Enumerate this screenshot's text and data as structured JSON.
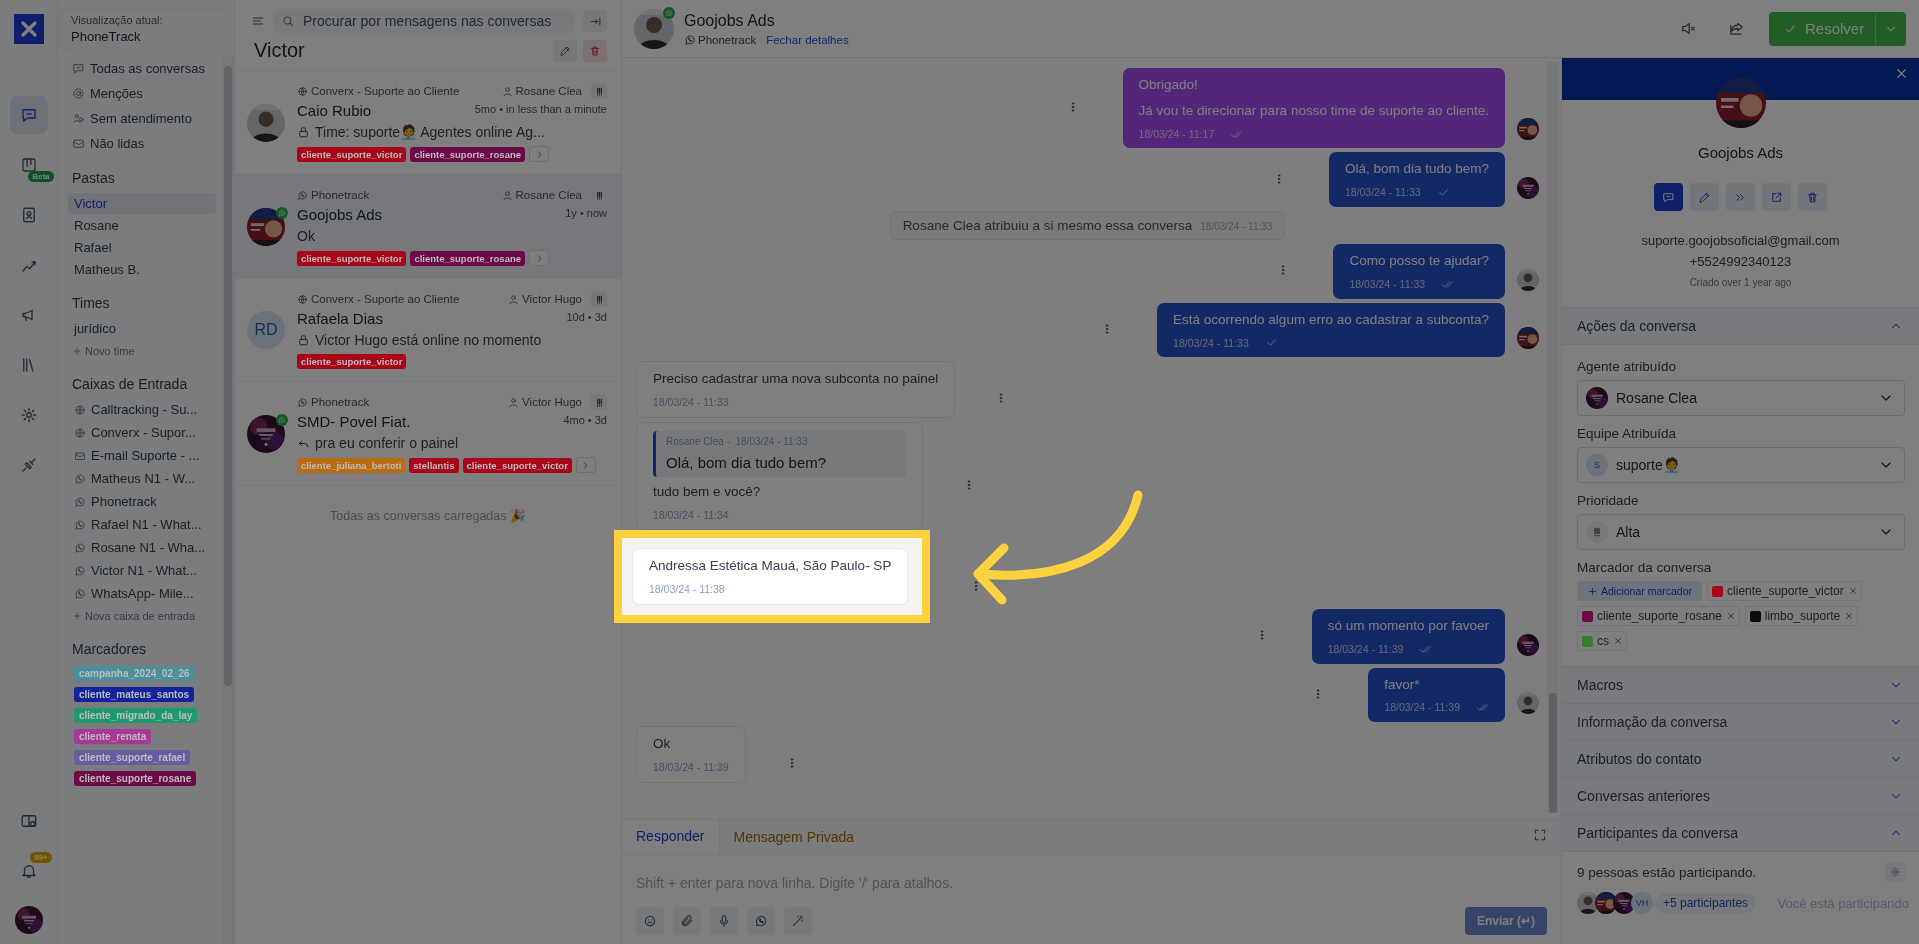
{
  "rail": {
    "items": [
      {
        "kind": "chat",
        "selected": true
      },
      {
        "kind": "board",
        "selected": false,
        "badge": "Beta"
      },
      {
        "kind": "contact",
        "selected": false
      },
      {
        "kind": "chart",
        "selected": false
      },
      {
        "kind": "megaphone",
        "selected": false
      },
      {
        "kind": "books",
        "selected": false
      },
      {
        "kind": "gear",
        "selected": false
      },
      {
        "kind": "plug",
        "selected": false
      }
    ],
    "bottom": [
      {
        "kind": "layout"
      },
      {
        "kind": "bell",
        "badge": "99+"
      }
    ],
    "avatar": {
      "kind": "picture"
    }
  },
  "sidebar": {
    "view": {
      "label": "Visualização atual:",
      "value": "PhoneTrack"
    },
    "nav": [
      {
        "kind": "chat",
        "label": "Todas as conversas"
      },
      {
        "kind": "mention",
        "label": "Menções"
      },
      {
        "kind": "people",
        "label": "Sem atendimento"
      },
      {
        "kind": "inbox",
        "label": "Não lidas"
      }
    ],
    "folders": {
      "title": "Pastas",
      "items": [
        {
          "label": "Victor",
          "selected": true
        },
        {
          "label": "Rosane",
          "selected": false
        },
        {
          "label": "Rafael",
          "selected": false
        },
        {
          "label": "Matheus B.",
          "selected": false
        }
      ]
    },
    "teams": {
      "title": "Times",
      "items": [
        "jurídico"
      ],
      "add": "Novo time"
    },
    "inboxes": {
      "title": "Caixas de Entrada",
      "items": [
        {
          "kind": "web",
          "label": "Calltracking - Su..."
        },
        {
          "kind": "web",
          "label": "Converx - Supor..."
        },
        {
          "kind": "email",
          "label": "E-mail Suporte - ..."
        },
        {
          "kind": "whatsapp",
          "label": "Matheus N1 - W..."
        },
        {
          "kind": "whatsapp",
          "label": "Phonetrack"
        },
        {
          "kind": "whatsapp",
          "label": "Rafael N1 - What..."
        },
        {
          "kind": "whatsapp",
          "label": "Rosane N1 - Wha..."
        },
        {
          "kind": "whatsapp",
          "label": "Victor N1 - What..."
        },
        {
          "kind": "whatsapp",
          "label": "WhatsApp- Mile..."
        }
      ],
      "add": "Nova caixa de entrada"
    },
    "labels": {
      "title": "Marcadores",
      "items": [
        {
          "label": "campanha_2024_02_26",
          "color": "#4a8f9b"
        },
        {
          "label": "cliente_mateus_santos",
          "color": "#14229c"
        },
        {
          "label": "cliente_migrado_da_lay",
          "color": "#1f9a70"
        },
        {
          "label": "cliente_renata",
          "color": "#a83896"
        },
        {
          "label": "cliente_suporte_rafael",
          "color": "#6a5aa0"
        },
        {
          "label": "cliente_suporte_rosane",
          "color": "#6c0a48"
        }
      ]
    }
  },
  "conversation_list": {
    "search": {
      "placeholder": "Procurar por mensagens nas conversas"
    },
    "title": "Victor",
    "items": [
      {
        "inbox": {
          "kind": "web",
          "name": "Converx - Suporte ao Cliente"
        },
        "agent": "Rosane Clea",
        "name": "Caio Rubio",
        "time": "5mo • in less than a minute",
        "preview": {
          "kind": "lock",
          "text": "Time: suporte🧑‍💼 Agentes online Ag..."
        },
        "avatar": {
          "kind": "picture"
        },
        "selected": false,
        "labels": [
          {
            "label": "cliente_suporte_victor",
            "color": "#a8041a"
          },
          {
            "label": "cliente_suporte_rosane",
            "color": "#6c0a48"
          }
        ],
        "more": true
      },
      {
        "inbox": {
          "kind": "whatsapp",
          "name": "Phonetrack"
        },
        "agent": "Rosane Clea",
        "name": "Goojobs Ads",
        "time": "1y • now",
        "preview": {
          "kind": "none",
          "text": "Ok"
        },
        "avatar": {
          "kind": "picture"
        },
        "selected": true,
        "labels": [
          {
            "label": "cliente_suporte_victor",
            "color": "#a8041a"
          },
          {
            "label": "cliente_suporte_rosane",
            "color": "#6c0a48"
          }
        ],
        "more": true
      },
      {
        "inbox": {
          "kind": "web",
          "name": "Converx - Suporte ao Cliente"
        },
        "agent": "Victor Hugo",
        "name": "Rafaela Dias",
        "time": "10d • 3d",
        "preview": {
          "kind": "lock",
          "text": "Victor Hugo está online no momento"
        },
        "avatar": {
          "kind": "initials",
          "initials": "RD"
        },
        "selected": false,
        "labels": [
          {
            "label": "cliente_suporte_victor",
            "color": "#a8041a"
          }
        ],
        "more": false
      },
      {
        "inbox": {
          "kind": "whatsapp",
          "name": "Phonetrack"
        },
        "agent": "Victor Hugo",
        "name": "SMD- Povel Fiat.",
        "time": "4mo • 3d",
        "preview": {
          "kind": "reply",
          "text": "pra eu conferir o painel"
        },
        "avatar": {
          "kind": "picture"
        },
        "selected": false,
        "labels": [
          {
            "label": "cliente_juliana_bertoti",
            "color": "#b86e10"
          },
          {
            "label": "stellantis",
            "color": "#a8041a"
          },
          {
            "label": "cliente_suporte_victor",
            "color": "#a8041a"
          }
        ],
        "more": true
      }
    ],
    "footer": "Todas as conversas carregadas 🎉"
  },
  "topbar": {
    "avatar": {
      "kind": "picture"
    },
    "name": "Goojobs Ads",
    "inbox": "Phonetrack",
    "close_link": "Fechar detalhes",
    "resolve": "Resolver"
  },
  "messages": [
    {
      "kind": "private",
      "lines": [
        "Obrigado!",
        "Já vou te direcionar para nosso time de suporte ao cliente."
      ],
      "time": "18/03/24 - 11:17",
      "read": true,
      "highlighted": false
    },
    {
      "kind": "outgoing",
      "lines": [
        "Olá, bom dia tudo bem?"
      ],
      "time": "18/03/24 - 11:33",
      "read": false,
      "highlighted": false
    },
    {
      "kind": "activity",
      "lines": [
        "Rosane Clea atribuiu a si mesmo essa conversa"
      ],
      "time": "18/03/24 - 11:33",
      "highlighted": false
    },
    {
      "kind": "outgoing",
      "lines": [
        "Como posso te ajudar?"
      ],
      "time": "18/03/24 - 11:33",
      "read": true,
      "highlighted": false
    },
    {
      "kind": "outgoing",
      "lines": [
        "Está ocorrendo algum erro ao cadastrar a subconta?"
      ],
      "time": "18/03/24 - 11:33",
      "read": false,
      "highlighted": false
    },
    {
      "kind": "incoming",
      "lines": [
        "Preciso cadastrar uma nova subconta no painel"
      ],
      "time": "18/03/24 - 11:33",
      "highlighted": false
    },
    {
      "kind": "incoming",
      "quote": {
        "author": "Rosane Clea -",
        "time": "18/03/24 - 11:33",
        "text": "Olá, bom dia tudo bem?"
      },
      "lines": [
        "tudo bem e você?"
      ],
      "time": "18/03/24 - 11:34",
      "highlighted": false
    },
    {
      "kind": "incoming",
      "lines": [
        "Andressa Estética Mauá, São Paulo- SP"
      ],
      "time": "18/03/24 - 11:38",
      "highlighted": true
    },
    {
      "kind": "outgoing",
      "lines": [
        "só um momento por favoer"
      ],
      "time": "18/03/24 - 11:39",
      "read": true,
      "highlighted": false
    },
    {
      "kind": "outgoing",
      "lines": [
        "favor*"
      ],
      "time": "18/03/24 - 11:39",
      "read": true,
      "highlighted": false
    },
    {
      "kind": "incoming",
      "lines": [
        "Ok"
      ],
      "time": "18/03/24 - 11:39",
      "highlighted": false
    }
  ],
  "composer": {
    "tabs": [
      {
        "label": "Responder",
        "selected": true
      },
      {
        "label": "Mensagem Privada",
        "selected": false
      }
    ],
    "placeholder": "Shift + enter para nova linha. Digite '/' para atalhos.",
    "tools": [
      {
        "kind": "emoji"
      },
      {
        "kind": "attach"
      },
      {
        "kind": "mic"
      },
      {
        "kind": "whatsapp"
      },
      {
        "kind": "wand"
      }
    ],
    "send": {
      "label": "Enviar (↵)",
      "disabled": true
    }
  },
  "details": {
    "contact": {
      "avatar": {
        "kind": "picture"
      },
      "name": "Goojobs Ads",
      "email": "suporte.goojobsoficial@gmail.com",
      "phone": "+5524992340123",
      "created": "Criado over 1 year ago"
    },
    "actions": [
      {
        "kind": "chat",
        "selected": true
      },
      {
        "kind": "edit",
        "selected": false
      },
      {
        "kind": "merge",
        "selected": false
      },
      {
        "kind": "export",
        "selected": false
      },
      {
        "kind": "delete",
        "selected": false
      }
    ],
    "sections": [
      {
        "kind": "actions",
        "title": "Ações da conversa",
        "expanded": true,
        "fields": [
          {
            "kind": "select",
            "label": "Agente atribuído",
            "value": "Rosane Clea",
            "avatar": {
              "kind": "picture"
            }
          },
          {
            "kind": "select",
            "label": "Equipe Atribuída",
            "value": "suporte🧑‍💼",
            "avatar": {
              "kind": "initials",
              "initials": "S"
            }
          },
          {
            "kind": "select",
            "label": "Prioridade",
            "value": "Alta",
            "avatar": {
              "kind": "priority"
            }
          },
          {
            "kind": "tags",
            "label": "Marcador da conversa",
            "add": "Adicionar marcador",
            "tags": [
              {
                "label": "cliente_suporte_victor",
                "color": "#a8041a"
              },
              {
                "label": "cliente_suporte_rosane",
                "color": "#6c0a48"
              },
              {
                "label": "limbo_suporte",
                "color": "#0d0d0d"
              },
              {
                "label": "cs",
                "color": "#3a7a30"
              }
            ]
          }
        ]
      },
      {
        "kind": "plain",
        "title": "Macros",
        "expanded": false
      },
      {
        "kind": "plain",
        "title": "Informação da conversa",
        "expanded": false
      },
      {
        "kind": "plain",
        "title": "Atributos do contato",
        "expanded": false
      },
      {
        "kind": "plain",
        "title": "Conversas anteriores",
        "expanded": false
      },
      {
        "kind": "participants",
        "title": "Participantes da conversa",
        "expanded": true,
        "count": "9 pessoas estão participando.",
        "avatars": [
          {
            "kind": "picture"
          },
          {
            "kind": "picture"
          },
          {
            "kind": "picture"
          },
          {
            "kind": "initials",
            "initials": "VH"
          }
        ],
        "more": "+5 participantes",
        "status": "Você está participando"
      }
    ]
  }
}
